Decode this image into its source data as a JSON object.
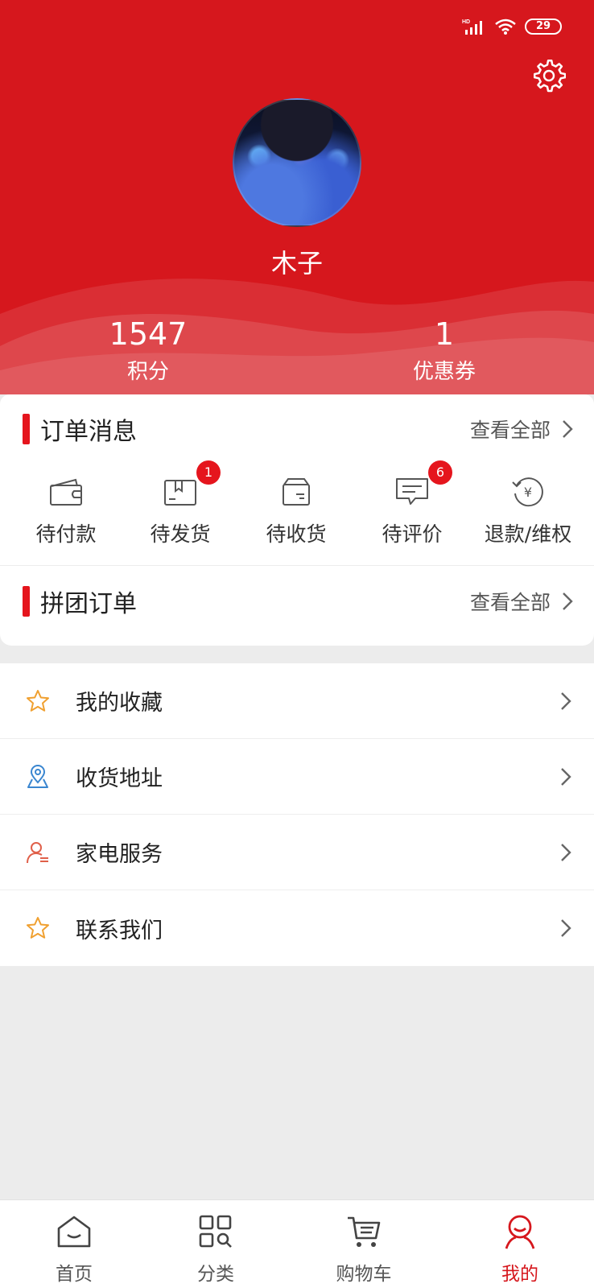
{
  "status_bar": {
    "network": "HD",
    "battery": "29"
  },
  "profile": {
    "username": "木子"
  },
  "stats": [
    {
      "value": "1547",
      "label": "积分"
    },
    {
      "value": "1",
      "label": "优惠券"
    }
  ],
  "orders": {
    "title": "订单消息",
    "view_all": "查看全部",
    "items": [
      {
        "label": "待付款",
        "icon": "wallet-icon",
        "badge": ""
      },
      {
        "label": "待发货",
        "icon": "package-icon",
        "badge": "1"
      },
      {
        "label": "待收货",
        "icon": "delivery-box-icon",
        "badge": ""
      },
      {
        "label": "待评价",
        "icon": "comment-icon",
        "badge": "6"
      },
      {
        "label": "退款/维权",
        "icon": "refund-icon",
        "badge": ""
      }
    ]
  },
  "group_orders": {
    "title": "拼团订单",
    "view_all": "查看全部"
  },
  "menu": [
    {
      "label": "我的收藏",
      "icon": "star-icon",
      "color": "#f0a030"
    },
    {
      "label": "收货地址",
      "icon": "location-icon",
      "color": "#3a86d0"
    },
    {
      "label": "家电服务",
      "icon": "person-service-icon",
      "color": "#e0604a"
    },
    {
      "label": "联系我们",
      "icon": "star-icon",
      "color": "#f0a030"
    }
  ],
  "bottom_nav": [
    {
      "label": "首页",
      "icon": "home-icon",
      "active": false
    },
    {
      "label": "分类",
      "icon": "category-icon",
      "active": false
    },
    {
      "label": "购物车",
      "icon": "cart-icon",
      "active": false
    },
    {
      "label": "我的",
      "icon": "profile-icon",
      "active": true
    }
  ],
  "colors": {
    "brand": "#d6171d",
    "accent_bar": "#e5151d",
    "background": "#ececec"
  }
}
